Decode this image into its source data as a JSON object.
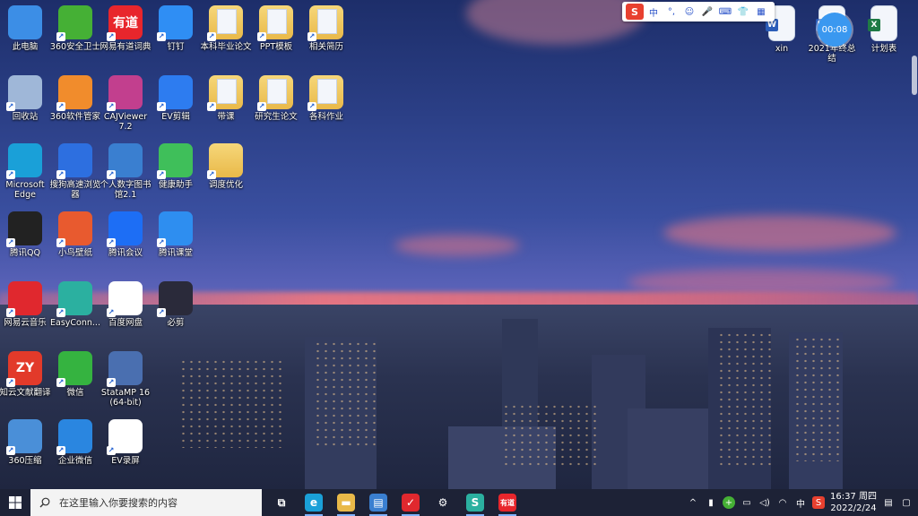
{
  "desktop": {
    "icons": [
      {
        "label": "此电脑",
        "icon": "computer-icon",
        "color": "#3c8ee6"
      },
      {
        "label": "360安全卫士",
        "icon": "360-security-icon",
        "color": "#45b035"
      },
      {
        "label": "网易有道词典",
        "icon": "youdao-dict-icon",
        "color": "#e8262c",
        "glyph": "有道"
      },
      {
        "label": "钉钉",
        "icon": "dingtalk-icon",
        "color": "#2f8ef4"
      },
      {
        "label": "本科毕业论文",
        "icon": "document-folder-icon"
      },
      {
        "label": "PPT模板",
        "icon": "document-folder-icon"
      },
      {
        "label": "相关简历",
        "icon": "document-folder-icon"
      },
      {
        "label": "回收站",
        "icon": "recycle-bin-icon",
        "color": "#9fb7d8"
      },
      {
        "label": "360软件管家",
        "icon": "360-software-icon",
        "color": "#f18c2c"
      },
      {
        "label": "CAJViewer 7.2",
        "icon": "cajviewer-icon",
        "color": "#c23f8e"
      },
      {
        "label": "EV剪辑",
        "icon": "ev-edit-icon",
        "color": "#2d7cf0"
      },
      {
        "label": "带课",
        "icon": "document-folder-icon"
      },
      {
        "label": "研究生论文",
        "icon": "document-folder-icon"
      },
      {
        "label": "各科作业",
        "icon": "document-folder-icon"
      },
      {
        "label": "Microsoft Edge",
        "icon": "edge-icon",
        "color": "#1aa0d8"
      },
      {
        "label": "搜狗高速浏览器",
        "icon": "sogou-browser-icon",
        "color": "#2d6fe0"
      },
      {
        "label": "个人数字图书馆2.1",
        "icon": "digital-library-icon",
        "color": "#3a7fd0"
      },
      {
        "label": "健康助手",
        "icon": "health-assistant-icon",
        "color": "#3fbf5a"
      },
      {
        "label": "调度优化",
        "icon": "folder-icon"
      },
      {
        "label": "腾讯QQ",
        "icon": "qq-icon",
        "color": "#222222"
      },
      {
        "label": "小鸟壁纸",
        "icon": "bird-wallpaper-icon",
        "color": "#e85a2f"
      },
      {
        "label": "腾讯会议",
        "icon": "tencent-meeting-icon",
        "color": "#1d6ef5"
      },
      {
        "label": "腾讯课堂",
        "icon": "tencent-classroom-icon",
        "color": "#2e8ef0"
      },
      {
        "label": "网易云音乐",
        "icon": "netease-music-icon",
        "color": "#e0282e"
      },
      {
        "label": "EasyConn...",
        "icon": "easyconnect-icon",
        "color": "#2bb0a0"
      },
      {
        "label": "百度网盘",
        "icon": "baidu-netdisk-icon",
        "color": "#ffffff"
      },
      {
        "label": "必剪",
        "icon": "bijian-icon",
        "color": "#2a2a3a"
      },
      {
        "label": "知云文献翻译",
        "icon": "zhiyun-translate-icon",
        "color": "#e23a2a",
        "glyph": "ZY"
      },
      {
        "label": "微信",
        "icon": "wechat-icon",
        "color": "#35b340"
      },
      {
        "label": "StataMP 16 (64-bit)",
        "icon": "stata-icon",
        "color": "#4a6fb0"
      },
      {
        "label": "360压缩",
        "icon": "360-zip-icon",
        "color": "#4a8fd8"
      },
      {
        "label": "企业微信",
        "icon": "wecom-icon",
        "color": "#2a86e0"
      },
      {
        "label": "EV录屏",
        "icon": "ev-record-icon",
        "color": "#ffffff"
      }
    ],
    "right_icons": [
      {
        "label": "xin",
        "icon": "word-doc-icon",
        "color": "#2b5db8"
      },
      {
        "label": "2021年终总结",
        "icon": "word-doc-icon",
        "color": "#2b5db8"
      },
      {
        "label": "计划表",
        "icon": "excel-icon",
        "color": "#1f7a45"
      }
    ]
  },
  "ime": {
    "logo": "S",
    "items": [
      "中",
      "°,",
      "☺",
      "🎤",
      "⌨",
      "👕",
      "▦"
    ]
  },
  "timer": {
    "value": "00:08"
  },
  "taskbar": {
    "search_placeholder": "在这里输入你要搜索的内容",
    "apps": [
      {
        "icon": "task-view-icon",
        "glyph": "⧉",
        "color": "transparent"
      },
      {
        "icon": "edge-icon",
        "glyph": "e",
        "color": "#1aa0d8"
      },
      {
        "icon": "file-explorer-icon",
        "glyph": "▬",
        "color": "#e9b949"
      },
      {
        "icon": "store-icon",
        "glyph": "▤",
        "color": "#3a7fd0"
      },
      {
        "icon": "wps-icon",
        "glyph": "✓",
        "color": "#e0282e"
      },
      {
        "icon": "settings-icon",
        "glyph": "⚙",
        "color": "transparent"
      },
      {
        "icon": "easyconnect-icon",
        "glyph": "S",
        "color": "#2bb0a0"
      },
      {
        "icon": "youdao-dict-icon",
        "glyph": "有道",
        "color": "#e8262c"
      }
    ],
    "tray": {
      "input_lang": "中",
      "time": "16:37 周四",
      "date": "2022/2/24"
    }
  }
}
